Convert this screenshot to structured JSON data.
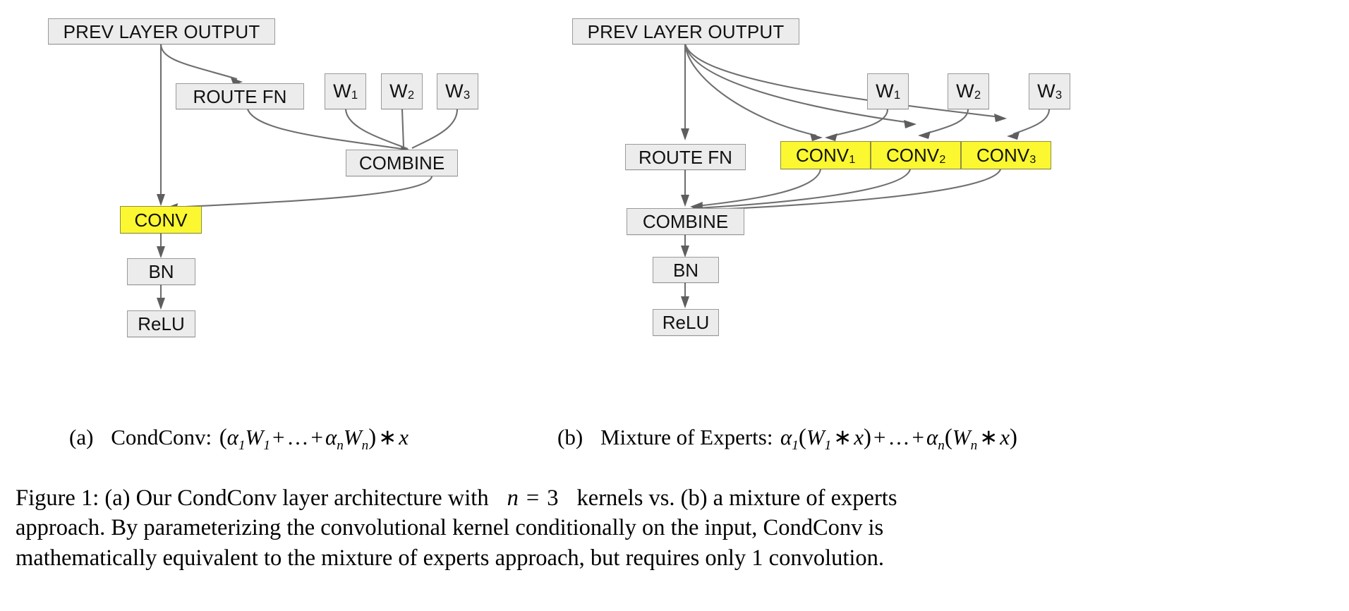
{
  "figure": {
    "label": "Figure 1:",
    "caption_lines": [
      "Figure 1: (a) Our CondConv layer architecture with n = 3 kernels vs. (b) a mixture of experts",
      "approach. By parameterizing the convolutional kernel conditionally on the input, CondConv is",
      "mathematically equivalent to the mixture of experts approach, but requires only 1 convolution."
    ],
    "caption_full": "Figure 1: (a) Our CondConv layer architecture with n = 3 kernels vs. (b) a mixture of experts approach. By parameterizing the convolutional kernel conditionally on the input, CondConv is mathematically equivalent to the mixture of experts approach, but requires only 1 convolution.",
    "line1": {
      "part_a": "Figure 1: (a) Our CondConv layer architecture with",
      "n_var": "n",
      "equals": "=",
      "n_value": "3",
      "part_b": "kernels vs. (b) a mixture of experts"
    },
    "line2": "approach. By parameterizing the convolutional kernel conditionally on the input, CondConv is",
    "line3": "mathematically equivalent to the mixture of experts approach, but requires only 1 convolution."
  },
  "colors": {
    "node_fill": "#ececec",
    "node_border": "#9a9a9a",
    "highlight_fill": "#fbf731",
    "edge_stroke": "#6f6f6f",
    "text": "#000000",
    "page_background": "#ffffff"
  },
  "panel_a": {
    "id": "a",
    "subcaption": {
      "tag": "(a)",
      "name": "CondConv:",
      "formula_plain": "(α1W1 + ... + αnWn) * x",
      "tokens": [
        {
          "t": "(",
          "k": "paren"
        },
        {
          "t": "α",
          "k": "greek"
        },
        {
          "t": "1",
          "k": "sub"
        },
        {
          "t": "W",
          "k": "var"
        },
        {
          "t": "1",
          "k": "sub"
        },
        {
          "t": "+",
          "k": "op"
        },
        {
          "t": "…",
          "k": "ell"
        },
        {
          "t": "+",
          "k": "op"
        },
        {
          "t": "α",
          "k": "greek"
        },
        {
          "t": "n",
          "k": "sub"
        },
        {
          "t": "W",
          "k": "var"
        },
        {
          "t": "n",
          "k": "sub"
        },
        {
          "t": ")",
          "k": "paren"
        },
        {
          "t": "∗",
          "k": "op"
        },
        {
          "t": "x",
          "k": "var"
        }
      ]
    },
    "nodes": [
      {
        "key": "prev",
        "label": "PREV LAYER OUTPUT",
        "sub": "",
        "highlight": false
      },
      {
        "key": "route",
        "label": "ROUTE FN",
        "sub": "",
        "highlight": false
      },
      {
        "key": "w1",
        "label": "W",
        "sub": "1",
        "highlight": false
      },
      {
        "key": "w2",
        "label": "W",
        "sub": "2",
        "highlight": false
      },
      {
        "key": "w3",
        "label": "W",
        "sub": "3",
        "highlight": false
      },
      {
        "key": "combine",
        "label": "COMBINE",
        "sub": "",
        "highlight": false
      },
      {
        "key": "conv",
        "label": "CONV",
        "sub": "",
        "highlight": true
      },
      {
        "key": "bn",
        "label": "BN",
        "sub": "",
        "highlight": false
      },
      {
        "key": "relu",
        "label": "ReLU",
        "sub": "",
        "highlight": false
      }
    ],
    "edges": [
      {
        "from": "prev",
        "to": "route"
      },
      {
        "from": "prev",
        "to": "conv"
      },
      {
        "from": "route",
        "to": "combine"
      },
      {
        "from": "w1",
        "to": "combine"
      },
      {
        "from": "w2",
        "to": "combine"
      },
      {
        "from": "w3",
        "to": "combine"
      },
      {
        "from": "combine",
        "to": "conv"
      },
      {
        "from": "conv",
        "to": "bn"
      },
      {
        "from": "bn",
        "to": "relu"
      }
    ]
  },
  "panel_b": {
    "id": "b",
    "subcaption": {
      "tag": "(b)",
      "name": "Mixture of Experts:",
      "formula_plain": "α1(W1 * x) + ... + αn(Wn * x)",
      "tokens": [
        {
          "t": "α",
          "k": "greek"
        },
        {
          "t": "1",
          "k": "sub"
        },
        {
          "t": "(",
          "k": "paren"
        },
        {
          "t": "W",
          "k": "var"
        },
        {
          "t": "1",
          "k": "sub"
        },
        {
          "t": "∗",
          "k": "op"
        },
        {
          "t": "x",
          "k": "var"
        },
        {
          "t": ")",
          "k": "paren"
        },
        {
          "t": "+",
          "k": "op"
        },
        {
          "t": "…",
          "k": "ell"
        },
        {
          "t": "+",
          "k": "op"
        },
        {
          "t": "α",
          "k": "greek"
        },
        {
          "t": "n",
          "k": "sub"
        },
        {
          "t": "(",
          "k": "paren"
        },
        {
          "t": "W",
          "k": "var"
        },
        {
          "t": "n",
          "k": "sub"
        },
        {
          "t": "∗",
          "k": "op"
        },
        {
          "t": "x",
          "k": "var"
        },
        {
          "t": ")",
          "k": "paren"
        }
      ]
    },
    "nodes": [
      {
        "key": "prev",
        "label": "PREV LAYER OUTPUT",
        "sub": "",
        "highlight": false
      },
      {
        "key": "route",
        "label": "ROUTE FN",
        "sub": "",
        "highlight": false
      },
      {
        "key": "w1",
        "label": "W",
        "sub": "1",
        "highlight": false
      },
      {
        "key": "w2",
        "label": "W",
        "sub": "2",
        "highlight": false
      },
      {
        "key": "w3",
        "label": "W",
        "sub": "3",
        "highlight": false
      },
      {
        "key": "conv1",
        "label": "CONV",
        "sub": "1",
        "highlight": true
      },
      {
        "key": "conv2",
        "label": "CONV",
        "sub": "2",
        "highlight": true
      },
      {
        "key": "conv3",
        "label": "CONV",
        "sub": "3",
        "highlight": true
      },
      {
        "key": "combine",
        "label": "COMBINE",
        "sub": "",
        "highlight": false
      },
      {
        "key": "bn",
        "label": "BN",
        "sub": "",
        "highlight": false
      },
      {
        "key": "relu",
        "label": "ReLU",
        "sub": "",
        "highlight": false
      }
    ],
    "edges": [
      {
        "from": "prev",
        "to": "route"
      },
      {
        "from": "prev",
        "to": "conv1"
      },
      {
        "from": "prev",
        "to": "conv2"
      },
      {
        "from": "prev",
        "to": "conv3"
      },
      {
        "from": "w1",
        "to": "conv1"
      },
      {
        "from": "w2",
        "to": "conv2"
      },
      {
        "from": "w3",
        "to": "conv3"
      },
      {
        "from": "route",
        "to": "combine"
      },
      {
        "from": "conv1",
        "to": "combine"
      },
      {
        "from": "conv2",
        "to": "combine"
      },
      {
        "from": "conv3",
        "to": "combine"
      },
      {
        "from": "combine",
        "to": "bn"
      },
      {
        "from": "bn",
        "to": "relu"
      }
    ]
  }
}
